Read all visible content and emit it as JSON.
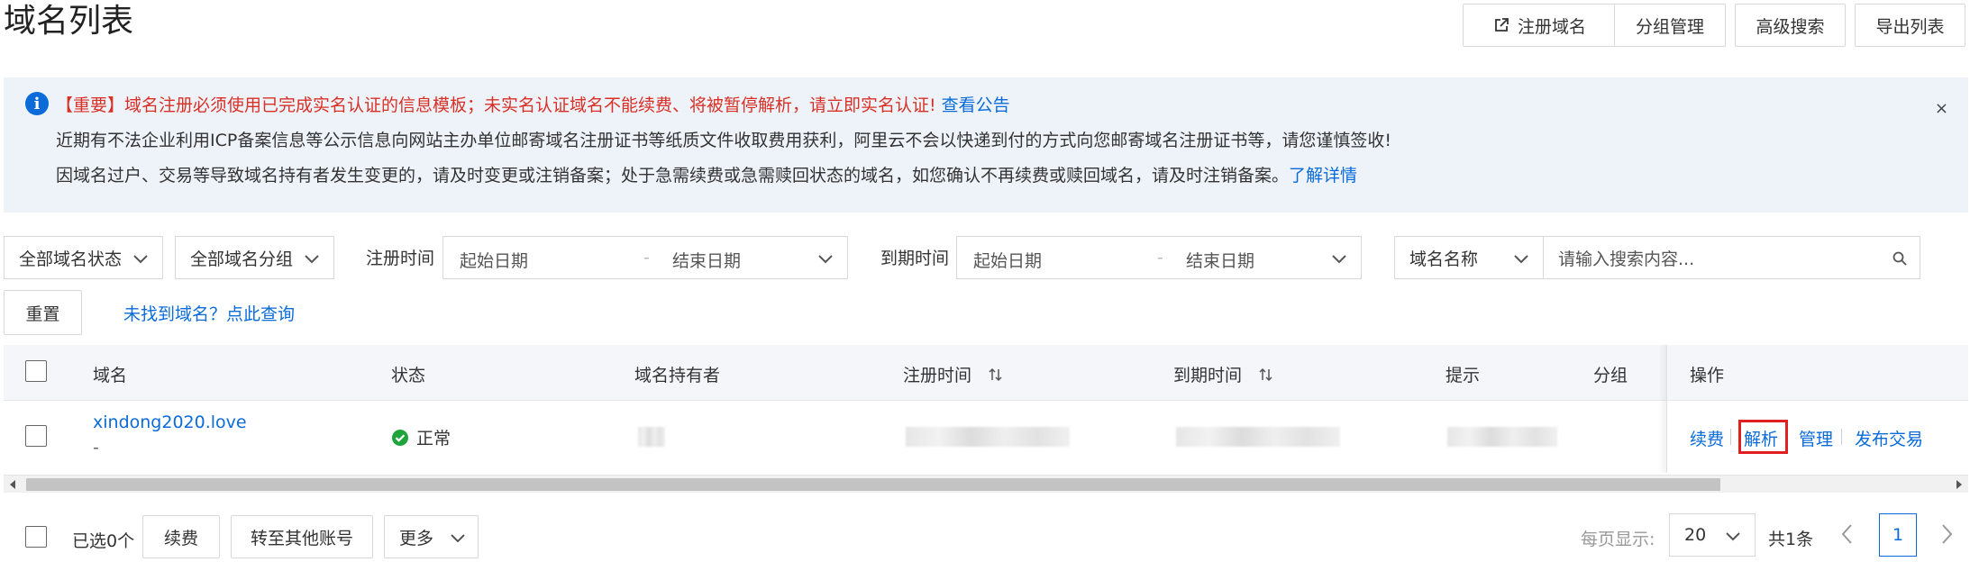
{
  "header": {
    "title": "域名列表",
    "buttons": {
      "register": "注册域名",
      "group_manage": "分组管理",
      "advanced_search": "高级搜索",
      "export": "导出列表"
    }
  },
  "notice": {
    "line1": "【重要】域名注册必须使用已完成实名认证的信息模板；未实名认证域名不能续费、将被暂停解析，请立即实名认证!",
    "line1_link": "查看公告",
    "line2": "近期有不法企业利用ICP备案信息等公示信息向网站主办单位邮寄域名注册证书等纸质文件收取费用获利，阿里云不会以快递到付的方式向您邮寄域名注册证书等，请您谨慎签收!",
    "line3": "因域名过户、交易等导致域名持有者发生变更的，请及时变更或注销备案；处于急需续费或急需赎回状态的域名，如您确认不再续费或赎回域名，请及时注销备案。",
    "line3_link": "了解详情",
    "close": "×"
  },
  "filters": {
    "status": "全部域名状态",
    "group": "全部域名分组",
    "reg_time_label": "注册时间",
    "exp_time_label": "到期时间",
    "start_placeholder": "起始日期",
    "end_placeholder": "结束日期",
    "range_sep": "-",
    "search_field": "域名名称",
    "search_placeholder": "请输入搜索内容...",
    "reset": "重置",
    "not_found_link": "未找到域名？点此查询"
  },
  "table": {
    "columns": [
      "域名",
      "状态",
      "域名持有者",
      "注册时间",
      "到期时间",
      "提示",
      "分组",
      "操作"
    ],
    "rows": [
      {
        "domain": "xindong2020.love",
        "domain_sub": "-",
        "status": "正常"
      }
    ],
    "operations": [
      "续费",
      "解析",
      "管理",
      "发布交易"
    ]
  },
  "footer": {
    "selected": "已选0个",
    "renew": "续费",
    "transfer": "转至其他账号",
    "more": "更多",
    "per_page_label": "每页显示:",
    "per_page_value": "20",
    "total": "共1条",
    "current_page": "1"
  },
  "colors": {
    "link": "#0a6bd9",
    "warning": "#d93026",
    "success": "#1fa43b",
    "notice_bg": "#eef3fa"
  }
}
